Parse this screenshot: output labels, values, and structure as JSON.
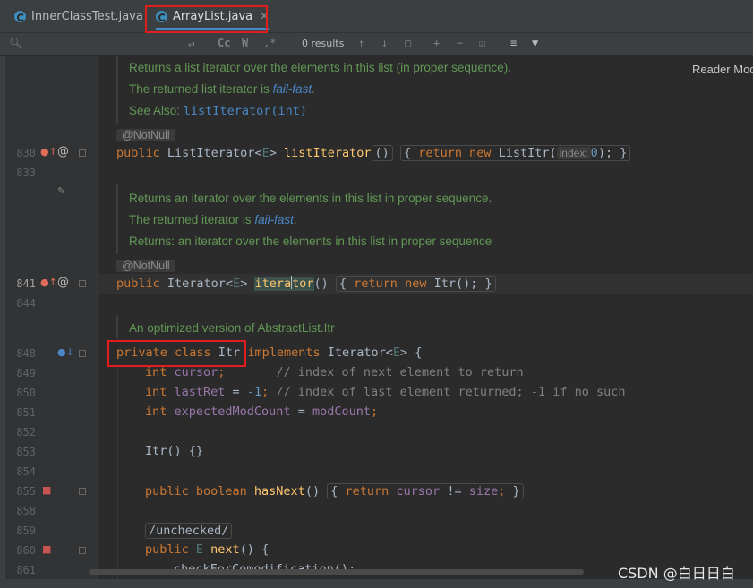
{
  "tabs": [
    {
      "label": "InnerClassTest.java",
      "active": false
    },
    {
      "label": "ArrayList.java",
      "active": true
    }
  ],
  "find": {
    "results": "0 results",
    "case_label": "Cc",
    "word_label": "W",
    "regex_label": ".*"
  },
  "reader_mode": "Reader Mod",
  "watermark": "CSDN @白日日白",
  "line_numbers": {
    "l830": "830",
    "l833": "833",
    "l841": "841",
    "l844": "844",
    "l848": "848",
    "l849": "849",
    "l850": "850",
    "l851": "851",
    "l852": "852",
    "l853": "853",
    "l854": "854",
    "l855": "855",
    "l858": "858",
    "l859": "859",
    "l860": "860",
    "l861": "861"
  },
  "doc1": {
    "line1": "Returns a list iterator over the elements in this list (in proper sequence).",
    "line2_pre": "The returned list iterator is ",
    "line2_em": "fail-fast",
    "line2_post": ".",
    "line3_pre": "See Also: ",
    "line3_link": "listIterator(int)"
  },
  "doc2": {
    "line1": "Returns an iterator over the elements in this list in proper sequence.",
    "line2_pre": "The returned iterator is ",
    "line2_em": "fail-fast",
    "line2_post": ".",
    "line3": "Returns: an iterator over the elements in this list in proper sequence"
  },
  "doc3": {
    "line1": "An optimized version of AbstractList.Itr"
  },
  "annotations": {
    "a1": "@NotNull",
    "a2": "@NotNull"
  },
  "code": {
    "c830": {
      "kw1": "public ",
      "type": "ListIterator<",
      "tp": "E",
      "type_end": "> ",
      "fn": "listIterator",
      "paren": "()",
      "brace_open": "{ ",
      "kw2": "return new ",
      "cls": "ListItr(",
      "hint": "index:",
      "num": "0",
      "end": "); ",
      "brace_close": "}"
    },
    "c841": {
      "kw1": "public ",
      "type": "Iterator<",
      "tp": "E",
      "type_end": "> ",
      "fn_a": "itera",
      "fn_b": "tor",
      "paren": "()",
      "brace_open": "{ ",
      "kw2": "return new ",
      "cls": "Itr(); ",
      "brace_close": "}"
    },
    "c848": {
      "kw1": "private class ",
      "cls": "Itr ",
      "kw2": "implements ",
      "type": "Iterator<",
      "tp": "E",
      "end": "> {"
    },
    "c849": {
      "kw": "int ",
      "fld": "cursor",
      "semi": ";       ",
      "cm": "// index of next element to return"
    },
    "c850": {
      "kw": "int ",
      "fld": "lastRet",
      "eq": " = ",
      "num": "-1",
      "semi": "; ",
      "cm": "// index of last element returned; -1 if no such"
    },
    "c851": {
      "kw": "int ",
      "fld": "expectedModCount",
      "eq": " = ",
      "fld2": "modCount",
      "semi": ";"
    },
    "c853": {
      "text": "Itr() {}"
    },
    "c855": {
      "kw1": "public boolean ",
      "fn": "hasNext",
      "paren": "()",
      "brace_open": "{ ",
      "kw2": "return ",
      "fld": "cursor",
      "ne": " != ",
      "fld2": "size",
      "semi": "; ",
      "brace_close": "}"
    },
    "c859": {
      "text": "/unchecked/"
    },
    "c860": {
      "kw1": "public ",
      "tp": "E ",
      "fn": "next",
      "end": "() {"
    },
    "c861": {
      "text": "checkForComodification();"
    }
  },
  "colors": {
    "highlight_box": "#e31d1d",
    "keyword": "#cc7832",
    "doc_text": "#629755"
  }
}
